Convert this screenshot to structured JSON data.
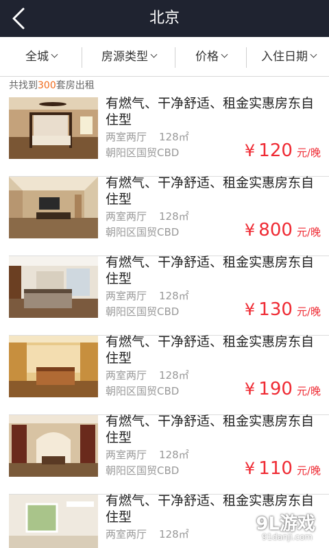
{
  "header": {
    "title": "北京",
    "back_icon": "chevron-left-icon"
  },
  "filters": [
    {
      "label": "全城"
    },
    {
      "label": "房源类型"
    },
    {
      "label": "价格"
    },
    {
      "label": "入住日期"
    }
  ],
  "result": {
    "prefix": "共找到",
    "count": "300",
    "suffix": "套房出租"
  },
  "listings": [
    {
      "title": "有燃气、干净舒适、租金实惠房东自住型",
      "rooms": "两室两厅",
      "area": "128㎡",
      "location": "朝阳区国贸CBD",
      "currency": "¥",
      "price": "120",
      "unit": "元/晚"
    },
    {
      "title": "有燃气、干净舒适、租金实惠房东自住型",
      "rooms": "两室两厅",
      "area": "128㎡",
      "location": "朝阳区国贸CBD",
      "currency": "¥",
      "price": "800",
      "unit": "元/晚"
    },
    {
      "title": "有燃气、干净舒适、租金实惠房东自住型",
      "rooms": "两室两厅",
      "area": "128㎡",
      "location": "朝阳区国贸CBD",
      "currency": "¥",
      "price": "130",
      "unit": "元/晚"
    },
    {
      "title": "有燃气、干净舒适、租金实惠房东自住型",
      "rooms": "两室两厅",
      "area": "128㎡",
      "location": "朝阳区国贸CBD",
      "currency": "¥",
      "price": "190",
      "unit": "元/晚"
    },
    {
      "title": "有燃气、干净舒适、租金实惠房东自住型",
      "rooms": "两室两厅",
      "area": "128㎡",
      "location": "朝阳区国贸CBD",
      "currency": "¥",
      "price": "110",
      "unit": "元/晚"
    },
    {
      "title": "有燃气、干净舒适、租金实惠房东自住型",
      "rooms": "两室两厅",
      "area": "128㎡",
      "location": "",
      "currency": "",
      "price": "",
      "unit": ""
    }
  ],
  "watermark": {
    "logo": "9L游戏",
    "site": "91danji.com"
  },
  "colors": {
    "nav_bg": "#1f2330",
    "accent": "#f06a1a",
    "price": "#ef2a33"
  }
}
